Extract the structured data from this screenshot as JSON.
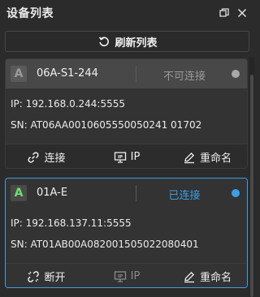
{
  "header": {
    "title": "设备列表"
  },
  "toolbar": {
    "refresh_label": "刷新列表"
  },
  "devices": [
    {
      "badge": "A",
      "name": "06A-S1-244",
      "status": "不可连接",
      "status_color": "#a8a8a8",
      "ip_line": "IP: 192.168.0.244:5555",
      "sn_line": "SN: AT06AA0010605550050241 01702",
      "actions": {
        "connect": "连接",
        "ip": "IP",
        "rename": "重命名"
      }
    },
    {
      "badge": "A",
      "name": "01A-E",
      "status": "已连接",
      "status_color": "#3a9fe8",
      "ip_line": "IP: 192.168.137.11:5555",
      "sn_line": "SN: AT01AB00A082001505022080401",
      "actions": {
        "disconnect": "断开",
        "ip": "IP",
        "rename": "重命名"
      }
    }
  ]
}
